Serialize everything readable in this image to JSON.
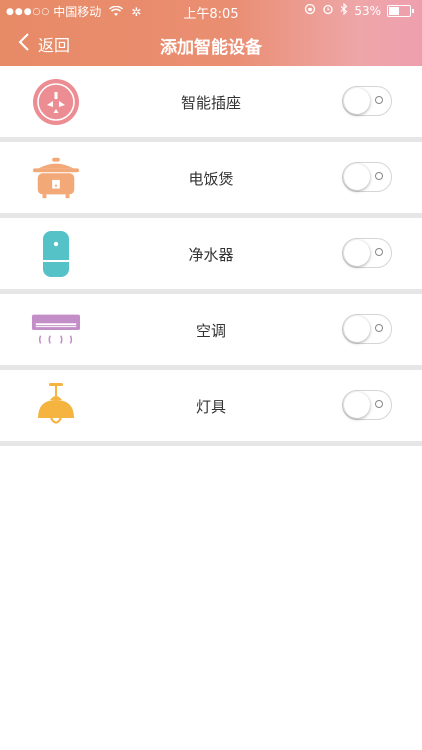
{
  "status_bar": {
    "signal": "●●●○○",
    "carrier": "中国移动",
    "time": "上午8:05",
    "battery_percent": "53%",
    "battery_level": 0.53
  },
  "nav": {
    "back_label": "返回",
    "title": "添加智能设备"
  },
  "devices": [
    {
      "label": "智能插座",
      "icon": "smart-plug-icon",
      "enabled": false,
      "color": "#ec8c93"
    },
    {
      "label": "电饭煲",
      "icon": "rice-cooker-icon",
      "enabled": false,
      "color": "#f3a878"
    },
    {
      "label": "净水器",
      "icon": "water-purifier-icon",
      "enabled": false,
      "color": "#55c2c8"
    },
    {
      "label": "空调",
      "icon": "air-conditioner-icon",
      "enabled": false,
      "color": "#c38dc8"
    },
    {
      "label": "灯具",
      "icon": "lamp-icon",
      "enabled": false,
      "color": "#f5b43f"
    }
  ],
  "colors": {
    "header_gradient_start": "#e78a66",
    "header_gradient_end": "#ee9fae",
    "separator": "#e6e6e6"
  }
}
